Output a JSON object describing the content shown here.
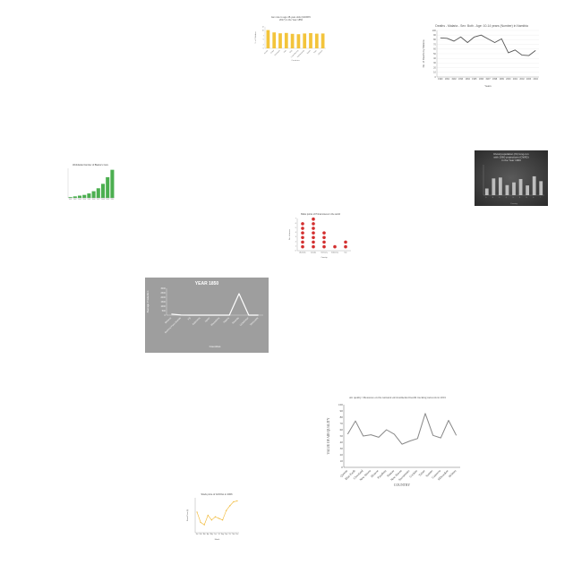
{
  "chart_data": [
    {
      "id": "pct-children",
      "type": "bar",
      "title": "Jan note to age 28-year-olds (GNWPC 2017) in the Year 1850",
      "xlabel": "Countries",
      "ylabel": "% of Children",
      "categories": [
        "Aruba",
        "Chad",
        "Denmark",
        "Iraq",
        "Italy",
        "Luxembourg",
        "Netherlands",
        "Spain",
        "Togo",
        "Ukraine"
      ],
      "values": [
        10.2,
        8.9,
        8.4,
        8.6,
        8.1,
        7.9,
        8.3,
        8.5,
        8.2,
        8.3
      ],
      "ylim": [
        0,
        12
      ],
      "color": "#f3c43b"
    },
    {
      "id": "malaria-deaths",
      "type": "line",
      "title": "Deaths - Malaria - Sex: Both - Age: 10-14 years (Number) in Namibia",
      "xlabel": "Years",
      "ylabel": "No. of Deaths by Malaria",
      "categories": [
        "1990",
        "1991",
        "1992",
        "1993",
        "1994",
        "1995",
        "1996",
        "1997",
        "1998",
        "1999",
        "2000",
        "2001",
        "2002",
        "2003",
        "2004"
      ],
      "values": [
        84,
        83,
        77,
        86,
        74,
        86,
        90,
        82,
        74,
        82,
        52,
        58,
        47,
        46,
        57
      ],
      "ylim": [
        0,
        100
      ],
      "yticks": [
        0,
        10,
        20,
        30,
        40,
        50,
        60,
        70,
        80,
        90,
        100
      ],
      "color": "#555555"
    },
    {
      "id": "blacks-cars",
      "type": "bar",
      "title": "Worldwide Number of Blacks's Cars",
      "xlabel": "",
      "ylabel": "",
      "categories": [
        "2001",
        "2002",
        "2003",
        "2004",
        "2005",
        "2006",
        "2007",
        "2008",
        "2009",
        "2010"
      ],
      "values": [
        1,
        2,
        3,
        4,
        6,
        9,
        13,
        19,
        28,
        38
      ],
      "ylim": [
        0,
        40
      ],
      "color": "#4caf50"
    },
    {
      "id": "rural-population",
      "type": "bar",
      "title": "Rural population (%) long-run with 1960 projections (OWID) in the Year 1900",
      "xlabel": "Country",
      "ylabel": "",
      "categories": [
        "A",
        "B",
        "C",
        "D",
        "E",
        "F",
        "G",
        "H",
        "I"
      ],
      "values": [
        22,
        55,
        58,
        33,
        42,
        53,
        32,
        62,
        46
      ],
      "ylim": [
        0,
        100
      ],
      "color": "#bdbdbd"
    },
    {
      "id": "stoves-dots",
      "type": "scatter",
      "title": "Bullet points of Primal stoves in the world",
      "xlabel": "Country",
      "ylabel": "No. of stoves",
      "categories": [
        "Australia",
        "Canada",
        "Germany",
        "Indonesia",
        "Iran"
      ],
      "values": [
        6,
        7,
        4,
        1,
        2
      ],
      "ylim": [
        0,
        7
      ],
      "color": "#d32f2f"
    },
    {
      "id": "year-1850",
      "type": "line",
      "title": "YEAR 1850",
      "xlabel": "Countries",
      "ylabel": "Average Production",
      "categories": [
        "Belarus",
        "Burkina Faso Islands",
        "Fiji",
        "Indonesia",
        "Japan",
        "Macedonia",
        "Nigeria",
        "Rwanda",
        "Uzbekistan",
        "Venezuela"
      ],
      "values": [
        120,
        10,
        0,
        0,
        0,
        0,
        0,
        2400,
        0,
        0
      ],
      "ylim": [
        0,
        3000
      ],
      "yticks": [
        0,
        500,
        1000,
        1500,
        2000,
        2500,
        3000
      ],
      "color": "#ffffff"
    },
    {
      "id": "air-quality",
      "type": "line",
      "title": "Air quality: Measures on the national environmental health tracking network in 2001",
      "xlabel": "COUNTRY",
      "ylabel": "VALUE OF AIR QUALITY",
      "categories": [
        "Queens",
        "Blue Earth",
        "Cleveland",
        "New Haven",
        "Monroe",
        "Pasadena",
        "Nassau",
        "New Haven",
        "Sacramento",
        "Cochise",
        "Tulare",
        "Sumter",
        "Cameron",
        "Milwaukee",
        "Holmes"
      ],
      "values": [
        53,
        74,
        50,
        52,
        48,
        60,
        53,
        37,
        42,
        46,
        86,
        51,
        47,
        75,
        51
      ],
      "ylim": [
        0,
        100
      ],
      "yticks": [
        0,
        10,
        20,
        30,
        40,
        50,
        60,
        70,
        80,
        90,
        100
      ],
      "color": "#888888"
    },
    {
      "id": "googl-price",
      "type": "line",
      "title": "Stock price of GOOGL in 2006",
      "xlabel": "Month",
      "ylabel": "Stock Price ($)",
      "categories": [
        "Jan",
        "Feb",
        "Mar",
        "Apr",
        "May",
        "Jun",
        "Jul",
        "Aug",
        "Sep",
        "Oct",
        "Nov",
        "Dec"
      ],
      "values": [
        430,
        365,
        350,
        410,
        380,
        400,
        390,
        380,
        440,
        470,
        495,
        500
      ],
      "ylim": [
        300,
        520
      ],
      "color": "#f0b429"
    }
  ]
}
